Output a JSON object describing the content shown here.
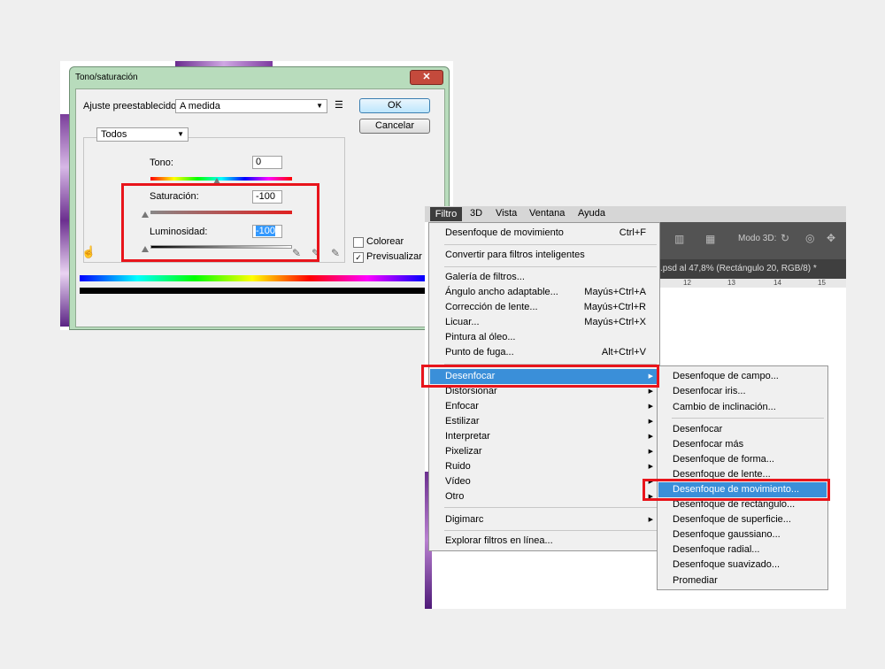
{
  "dialog": {
    "title": "Tono/saturación",
    "close_label": "✕",
    "preset_label": "Ajuste preestablecido:",
    "preset_value": "A medida",
    "ok_label": "OK",
    "cancel_label": "Cancelar",
    "channel_value": "Todos",
    "hue_label": "Tono:",
    "hue_value": "0",
    "saturation_label": "Saturación:",
    "saturation_value": "-100",
    "lightness_label": "Luminosidad:",
    "lightness_value": "-100",
    "colorize_label": "Colorear",
    "preview_label": "Previsualizar",
    "preview_check": "✓"
  },
  "photoshop": {
    "menubar": [
      "Filtro",
      "3D",
      "Vista",
      "Ventana",
      "Ayuda"
    ],
    "toolbar_text": "Modo 3D:",
    "tab_text": ".psd al 47,8% (Rectángulo 20, RGB/8) *",
    "ruler_ticks": [
      "12",
      "13",
      "14",
      "15"
    ]
  },
  "filter_menu": {
    "items": [
      {
        "label": "Desenfoque de movimiento",
        "shortcut": "Ctrl+F"
      },
      {
        "label": "Convertir para filtros inteligentes"
      },
      {
        "label": "Galería de filtros..."
      },
      {
        "label": "Ángulo ancho adaptable...",
        "shortcut": "Mayús+Ctrl+A"
      },
      {
        "label": "Corrección de lente...",
        "shortcut": "Mayús+Ctrl+R"
      },
      {
        "label": "Licuar...",
        "shortcut": "Mayús+Ctrl+X"
      },
      {
        "label": "Pintura al óleo..."
      },
      {
        "label": "Punto de fuga...",
        "shortcut": "Alt+Ctrl+V"
      },
      {
        "label": "Desenfocar"
      },
      {
        "label": "Distorsionar"
      },
      {
        "label": "Enfocar"
      },
      {
        "label": "Estilizar"
      },
      {
        "label": "Interpretar"
      },
      {
        "label": "Pixelizar"
      },
      {
        "label": "Ruido"
      },
      {
        "label": "Vídeo"
      },
      {
        "label": "Otro"
      },
      {
        "label": "Digimarc"
      },
      {
        "label": "Explorar filtros en línea..."
      }
    ]
  },
  "blur_submenu": {
    "items": [
      "Desenfoque de campo...",
      "Desenfocar iris...",
      "Cambio de inclinación...",
      "Desenfocar",
      "Desenfocar más",
      "Desenfoque de forma...",
      "Desenfoque de lente...",
      "Desenfoque de movimiento...",
      "Desenfoque de rectángulo...",
      "Desenfoque de superficie...",
      "Desenfoque gaussiano...",
      "Desenfoque radial...",
      "Desenfoque suavizado...",
      "Promediar"
    ]
  },
  "colors": {
    "highlight": "#3a8fd9",
    "annotation_red": "#e8141b",
    "dialog_frame": "#b8dcbc"
  }
}
